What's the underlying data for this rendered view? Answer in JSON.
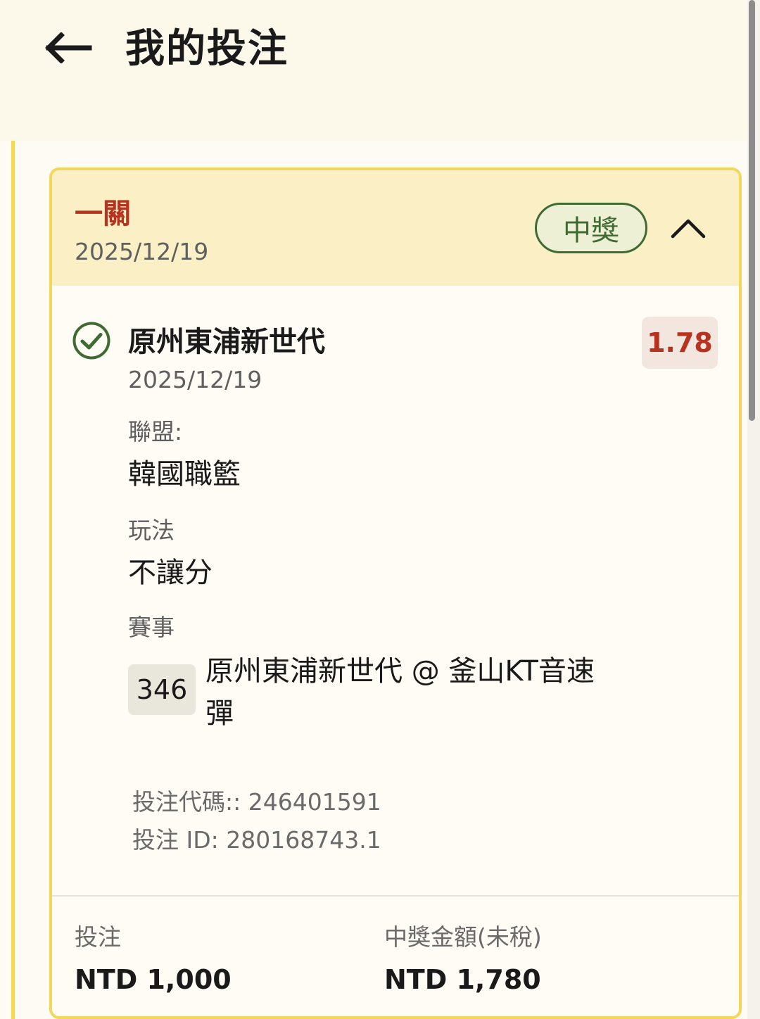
{
  "header": {
    "title": "我的投注",
    "back_icon": "arrow-left-icon"
  },
  "bet": {
    "type_label": "一關",
    "date": "2025/12/19",
    "status": "中獎",
    "status_color": "#3f6b33",
    "collapse_icon": "chevron-up-icon",
    "selection": {
      "status_icon": "check-circle-icon",
      "team": "原州東浦新世代",
      "odds": "1.78",
      "date": "2025/12/19",
      "league_label": "聯盟:",
      "league": "韓國職籃",
      "market_label": "玩法",
      "market": "不讓分",
      "event_label": "賽事",
      "match_number": "346",
      "match_name": "原州東浦新世代 @ 釜山KT音速彈"
    },
    "bet_code": "投注代碼:: 246401591",
    "bet_id": "投注 ID: 280168743.1",
    "stake_label": "投注",
    "stake_value": "NTD 1,000",
    "payout_label": "中獎金額(未稅)",
    "payout_value": "NTD 1,780"
  },
  "colors": {
    "accent_yellow": "#f2d75a",
    "header_band": "#fbf0c5",
    "odds_red": "#b7331f",
    "win_green": "#3f6b33"
  }
}
